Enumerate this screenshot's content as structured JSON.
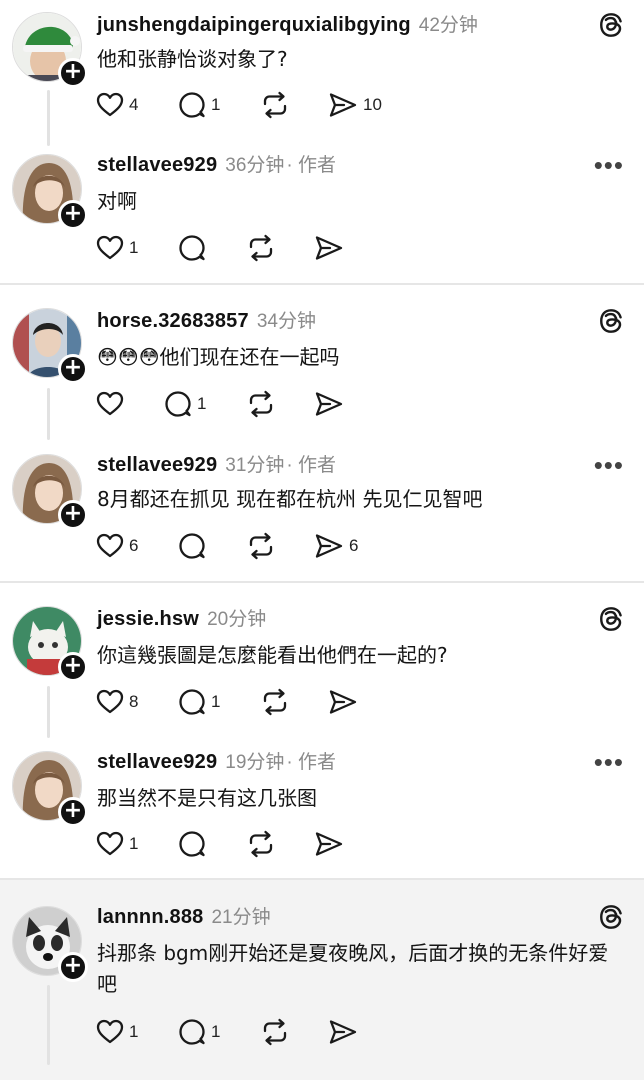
{
  "comments": [
    {
      "username": "junshengdaipingerquxialibgying",
      "time": "42分钟",
      "author_tag": "",
      "text": "他和张静怡谈对象了?",
      "likes": "4",
      "replies": "1",
      "reposts": "",
      "shares": "10",
      "avatar": "green-hat-avatar"
    },
    {
      "username": "stellavee929",
      "time": "36分钟",
      "author_tag": "· 作者",
      "text": "对啊",
      "likes": "1",
      "replies": "",
      "reposts": "",
      "shares": "",
      "avatar": "woman-avatar"
    },
    {
      "username": "horse.32683857",
      "time": "34分钟",
      "author_tag": "",
      "text": "😳😳😳他们现在还在一起吗",
      "likes": "",
      "replies": "1",
      "reposts": "",
      "shares": "",
      "avatar": "man-avatar"
    },
    {
      "username": "stellavee929",
      "time": "31分钟",
      "author_tag": "· 作者",
      "text": "8月都还在抓见 现在都在杭州 先见仁见智吧",
      "likes": "6",
      "replies": "",
      "reposts": "",
      "shares": "6",
      "avatar": "woman-avatar"
    },
    {
      "username": "jessie.hsw",
      "time": "20分钟",
      "author_tag": "",
      "text": "你這幾張圖是怎麼能看出他們在一起的?",
      "likes": "8",
      "replies": "1",
      "reposts": "",
      "shares": "",
      "avatar": "cat-avatar"
    },
    {
      "username": "stellavee929",
      "time": "19分钟",
      "author_tag": "· 作者",
      "text": "那当然不是只有这几张图",
      "likes": "1",
      "replies": "",
      "reposts": "",
      "shares": "",
      "avatar": "woman-avatar"
    },
    {
      "username": "lannnn.888",
      "time": "21分钟",
      "author_tag": "",
      "text": "抖那条 bgm刚开始还是夏夜晚风，后面才换的无条件好爱吧",
      "likes": "1",
      "replies": "1",
      "reposts": "",
      "shares": "",
      "avatar": "dog-avatar"
    }
  ],
  "icons": {
    "threads": "threads-logo-icon",
    "more": "more-dots-icon",
    "like": "heart-icon",
    "reply": "comment-bubble-icon",
    "repost": "repost-icon",
    "share": "send-icon"
  },
  "colors": {
    "background": "#ffffff",
    "last_section": "#f3f3f3",
    "divider": "#e6e6e6",
    "muted": "#8a8a8a"
  }
}
